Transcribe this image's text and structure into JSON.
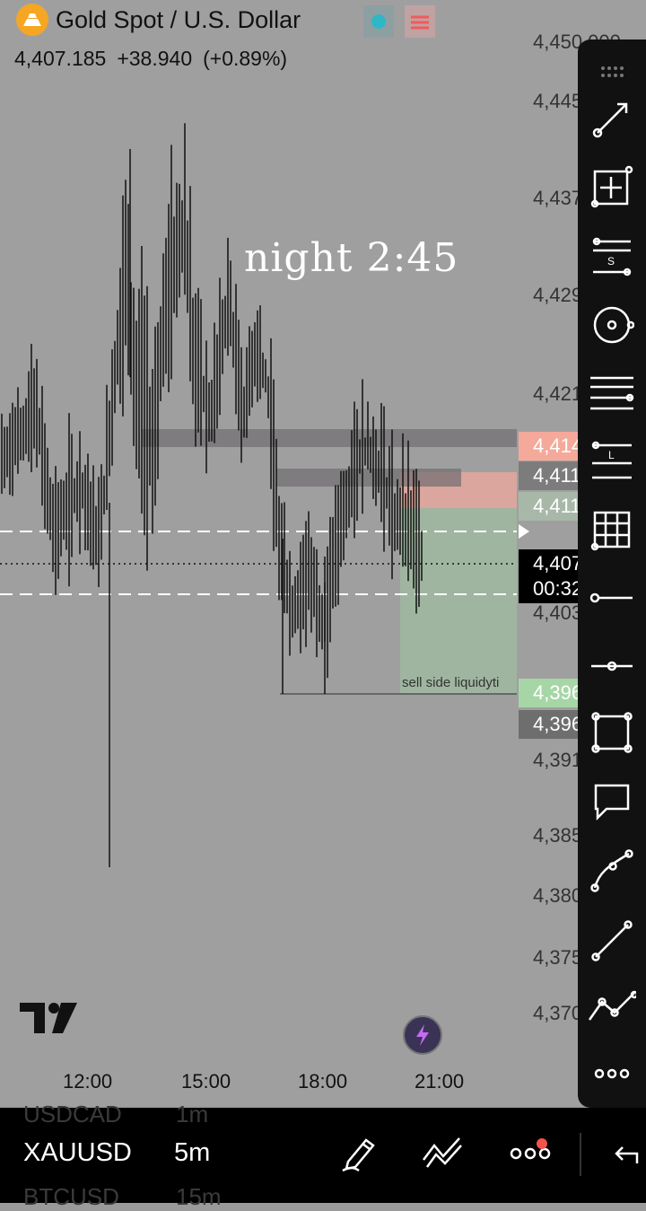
{
  "header": {
    "symbol_title": "Gold Spot / U.S. Dollar",
    "last_price": "4,407.185",
    "change": "+38.940",
    "change_pct": "(+0.89%)"
  },
  "overlay_title": "night  2:45",
  "price_axis": {
    "ticks": [
      "4,450.000",
      "4,445",
      "4,437",
      "4,429",
      "4,421",
      "4,403",
      "4,391",
      "4,385",
      "4,380",
      "4,375",
      "4,370"
    ],
    "labels": [
      {
        "text": "4,414",
        "bg": "#f4a99a",
        "fg": "#ffffff"
      },
      {
        "text": "4,411",
        "bg": "#7d7c7d",
        "fg": "#ffffff"
      },
      {
        "text": "4,411",
        "bg": "#a8b8a8",
        "fg": "#ffffff"
      },
      {
        "text": "4,407",
        "bg": "#000000",
        "fg": "#ffffff"
      },
      {
        "text": "00:32",
        "bg": "#000000",
        "fg": "#ffffff"
      },
      {
        "text": "4,396",
        "bg": "#a6d6a6",
        "fg": "#ffffff"
      },
      {
        "text": "4,396",
        "bg": "#6f6e6f",
        "fg": "#ffffff"
      }
    ]
  },
  "time_axis": {
    "ticks": [
      "12:00",
      "15:00",
      "18:00",
      "21:00"
    ]
  },
  "annotation": {
    "sell_side": "sell side liquidyti"
  },
  "bottom_bar": {
    "ghost_top_symbol": "USDCAD",
    "ghost_top_interval": "1m",
    "symbol": "XAUUSD",
    "interval": "5m",
    "ghost_bottom_symbol": "BTCUSD",
    "ghost_bottom_interval": "15m"
  },
  "toolbar": {
    "icons": [
      "drag-handle-icon",
      "trend-line-icon",
      "crosshair-box-icon",
      "fib-retracement-icon",
      "circle-target-icon",
      "parallel-channel-icon",
      "long-position-icon",
      "grid-icon",
      "horizontal-ray-icon",
      "horizontal-line-icon",
      "rectangle-icon",
      "comment-icon",
      "curve-icon",
      "line-icon",
      "path-icon",
      "more-icon"
    ]
  },
  "colors": {
    "chart_bg": "#a09fa0",
    "sell_zone": "#9fb5a0",
    "sell_top_zone": "#e9a79c",
    "accent_bolt": "#c56bf0"
  }
}
